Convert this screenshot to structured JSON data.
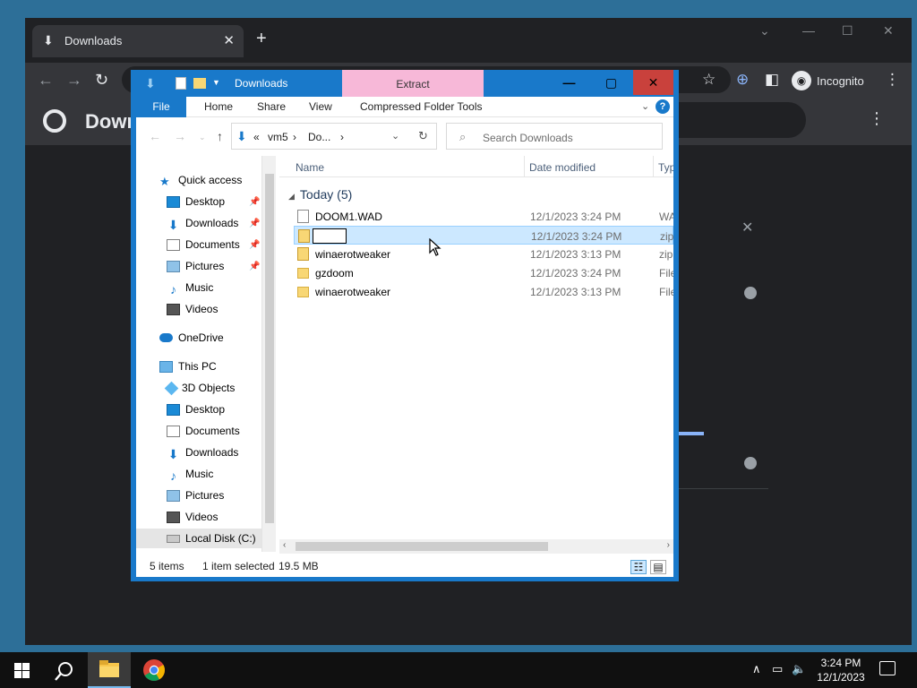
{
  "chrome": {
    "tab_title": "Downloads",
    "page_title": "Down",
    "incognito_label": "Incognito"
  },
  "explorer": {
    "window_title": "Downloads",
    "context_tab": "Extract",
    "ribbon_tabs": [
      "File",
      "Home",
      "Share",
      "View",
      "Compressed Folder Tools"
    ],
    "address": {
      "overflow": "«",
      "seg1": "vm5",
      "seg2": "Do...",
      "sep": "›"
    },
    "search_placeholder": "Search Downloads",
    "nav": {
      "quick_access": "Quick access",
      "quick_items": [
        "Desktop",
        "Downloads",
        "Documents",
        "Pictures",
        "Music",
        "Videos"
      ],
      "onedrive": "OneDrive",
      "this_pc": "This PC",
      "pc_items": [
        "3D Objects",
        "Desktop",
        "Documents",
        "Downloads",
        "Music",
        "Pictures",
        "Videos",
        "Local Disk (C:)"
      ]
    },
    "columns": {
      "name": "Name",
      "date": "Date modified",
      "type": "Typ"
    },
    "group_label": "Today (5)",
    "files": [
      {
        "name": "DOOM1.WAD",
        "date": "12/1/2023 3:24 PM",
        "type": "WA",
        "kind": "wad"
      },
      {
        "name": "",
        "date": "12/1/2023 3:24 PM",
        "type": "zip",
        "kind": "zip"
      },
      {
        "name": "winaerotweaker",
        "date": "12/1/2023 3:13 PM",
        "type": "zip",
        "kind": "zip"
      },
      {
        "name": "gzdoom",
        "date": "12/1/2023 3:24 PM",
        "type": "File",
        "kind": "folder"
      },
      {
        "name": "winaerotweaker",
        "date": "12/1/2023 3:13 PM",
        "type": "File",
        "kind": "folder"
      }
    ],
    "status": {
      "count": "5 items",
      "selected": "1 item selected",
      "size": "19.5 MB"
    }
  },
  "taskbar": {
    "time": "3:24 PM",
    "date": "12/1/2023"
  },
  "colors": {
    "explorer_accent": "#1979ca",
    "extract_tab": "#f7b8d8",
    "selection": "#cce8ff",
    "chrome_bg": "#202124"
  }
}
